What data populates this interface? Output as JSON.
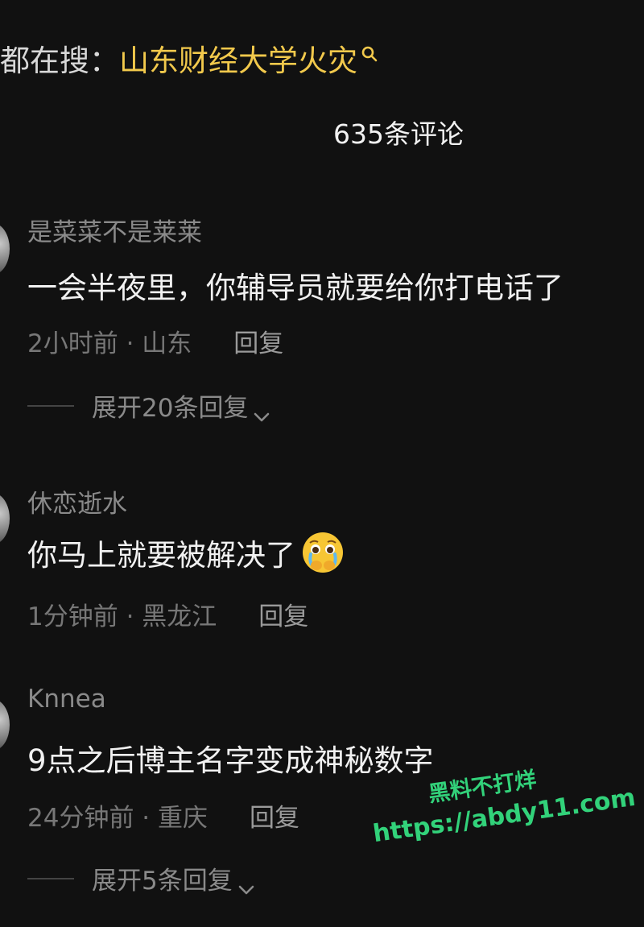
{
  "search": {
    "prefix": "都在搜：",
    "term": "山东财经大学火灾"
  },
  "header": {
    "comment_count_label": "635条评论"
  },
  "comments": [
    {
      "username": "是菜菜不是莱莱",
      "content": "一会半夜里，你辅导员就要给你打电话了",
      "time_location": "2小时前 · 山东",
      "reply_label": "回复",
      "expand_label": "展开20条回复"
    },
    {
      "username": "休恋逝水",
      "content": "你马上就要被解决了",
      "emoji": "crying-face-emoji",
      "time_location": "1分钟前 · 黑龙江",
      "reply_label": "回复"
    },
    {
      "username": "Knnea",
      "content": "9点之后博主名字变成神秘数字",
      "time_location": "24分钟前 · 重庆",
      "reply_label": "回复",
      "expand_label": "展开5条回复"
    }
  ],
  "watermark": {
    "line1": "黑料不打烊",
    "line2": "https://abdy11.com"
  },
  "colors": {
    "background": "#111111",
    "search_term": "#f2c94c",
    "watermark": "#32d27a",
    "muted_text": "#8a8a8a"
  }
}
